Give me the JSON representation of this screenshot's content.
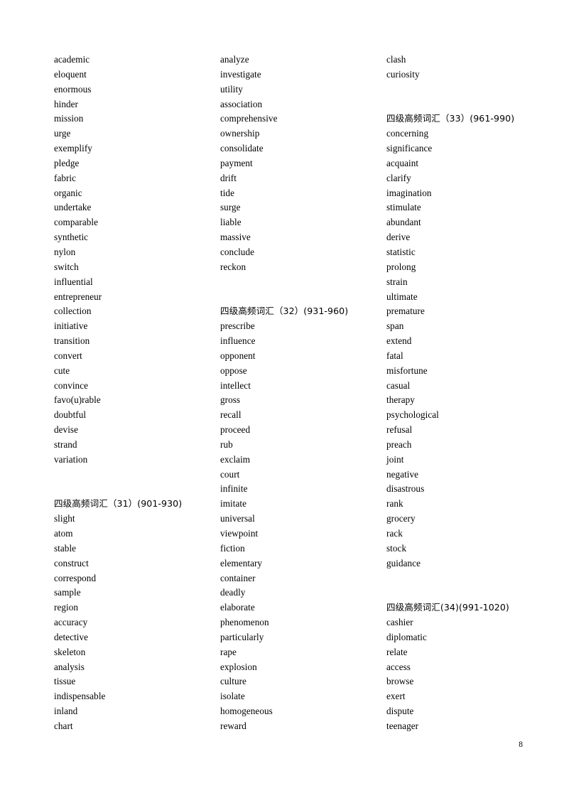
{
  "document": {
    "page_number": "8",
    "text_color": "#000000",
    "background_color": "#ffffff"
  },
  "columns": [
    {
      "name": "column-1",
      "blocks": [
        {
          "type": "words",
          "items": [
            "academic",
            "eloquent",
            "enormous",
            "hinder",
            "mission",
            "urge",
            "exemplify",
            "pledge",
            "fabric",
            "organic",
            "undertake",
            "comparable",
            "synthetic",
            "nylon",
            "switch",
            "influential",
            "entrepreneur",
            "collection",
            "initiative",
            "transition",
            "convert",
            "cute",
            "convince",
            "favo(u)rable",
            "doubtful",
            "devise",
            "strand",
            "variation"
          ]
        },
        {
          "type": "spacer",
          "count": 2
        },
        {
          "type": "heading",
          "text": "四级高频词汇（31）(901-930)"
        },
        {
          "type": "words",
          "items": [
            "slight",
            "atom",
            "stable",
            "construct",
            "correspond",
            "sample",
            "region",
            "accuracy",
            "detective",
            "skeleton",
            "analysis",
            "tissue",
            "indispensable",
            "inland",
            "chart"
          ]
        }
      ]
    },
    {
      "name": "column-2",
      "blocks": [
        {
          "type": "words",
          "items": [
            "analyze",
            "investigate",
            "utility",
            "association",
            "comprehensive",
            "ownership",
            "consolidate",
            "payment",
            "drift",
            "tide",
            "surge",
            "liable",
            "massive",
            "conclude",
            "reckon"
          ]
        },
        {
          "type": "spacer",
          "count": 2
        },
        {
          "type": "heading",
          "text": "四级高频词汇（32）(931-960)"
        },
        {
          "type": "words",
          "items": [
            "prescribe",
            "influence",
            "opponent",
            "oppose",
            "intellect",
            "gross",
            "recall",
            "proceed",
            "rub",
            "exclaim",
            "court",
            "infinite",
            "imitate",
            "universal",
            "viewpoint",
            "fiction",
            "elementary",
            "container",
            "deadly",
            "elaborate",
            "phenomenon",
            "particularly",
            "rape",
            "explosion",
            "culture",
            "isolate",
            "homogeneous",
            "reward"
          ]
        }
      ]
    },
    {
      "name": "column-3",
      "blocks": [
        {
          "type": "words",
          "items": [
            "clash",
            "curiosity"
          ]
        },
        {
          "type": "spacer",
          "count": 2
        },
        {
          "type": "heading",
          "text": "四级高频词汇（33）(961-990)"
        },
        {
          "type": "words",
          "items": [
            "concerning",
            "significance",
            "acquaint",
            "clarify",
            "imagination",
            "stimulate",
            "abundant",
            "derive",
            "statistic",
            "prolong",
            "strain",
            "ultimate",
            "premature",
            "span",
            "extend",
            "fatal",
            "misfortune",
            "casual",
            "therapy",
            "psychological",
            "refusal",
            "preach",
            "joint",
            "negative",
            "disastrous",
            "rank",
            "grocery",
            "rack",
            "stock",
            "guidance"
          ]
        },
        {
          "type": "spacer",
          "count": 2
        },
        {
          "type": "heading",
          "text": "四级高频词汇(34)(991-1020)"
        },
        {
          "type": "words",
          "items": [
            "cashier",
            "diplomatic",
            "relate",
            "access",
            "browse",
            "exert",
            "dispute",
            "teenager"
          ]
        }
      ]
    }
  ]
}
